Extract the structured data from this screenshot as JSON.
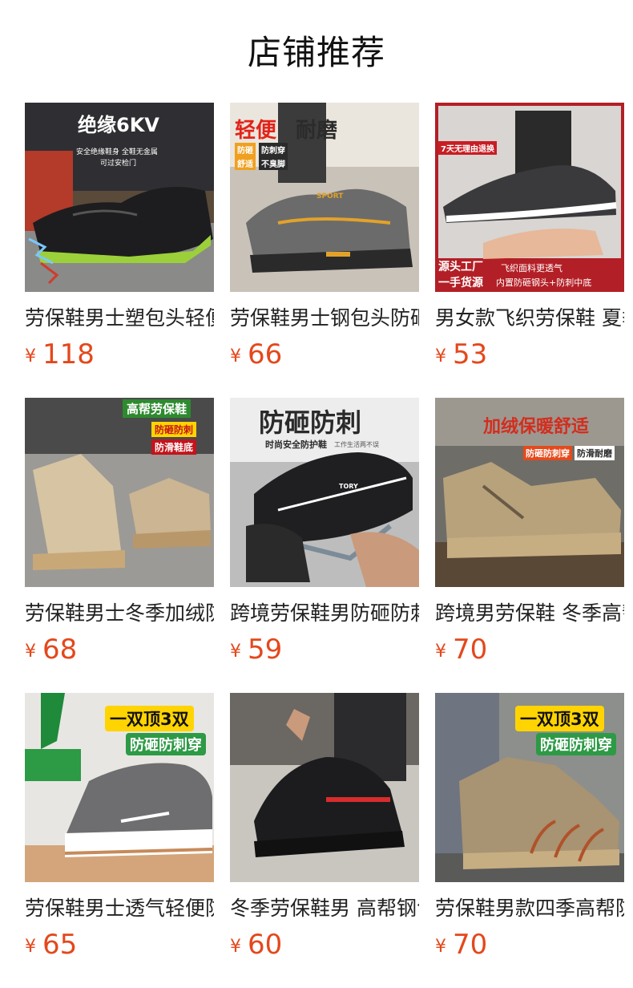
{
  "page": {
    "title": "店铺推荐",
    "currency_symbol": "¥",
    "price_color": "#e4481c"
  },
  "products": [
    {
      "name": "劳保鞋男士塑包头轻便",
      "price": "118",
      "image": {
        "theme": "dark",
        "labels": [
          "绝缘6KV",
          "安全绝缘鞋身 全鞋无金属",
          "可过安检门"
        ]
      }
    },
    {
      "name": "劳保鞋男士钢包头防砸",
      "price": "66",
      "image": {
        "theme": "grey",
        "labels": [
          "轻便",
          "耐磨",
          "防砸",
          "防刺穿",
          "舒适",
          "不臭脚",
          "SPORT"
        ]
      }
    },
    {
      "name": "男女款飞织劳保鞋 夏季",
      "price": "53",
      "image": {
        "theme": "red",
        "labels": [
          "7天无理由退换",
          "源头工厂",
          "一手货源",
          "飞织面料更透气",
          "内置防砸钢头+防刺中底"
        ]
      }
    },
    {
      "name": "劳保鞋男士冬季加绒防砸",
      "price": "68",
      "image": {
        "theme": "beige",
        "labels": [
          "高帮劳保鞋",
          "防砸防刺",
          "防滑鞋底"
        ]
      }
    },
    {
      "name": "跨境劳保鞋男防砸防刺",
      "price": "59",
      "image": {
        "theme": "black",
        "labels": [
          "防砸防刺",
          "时尚安全防护鞋",
          "工作生活两不误",
          "TORY"
        ]
      }
    },
    {
      "name": "跨境男劳保鞋 冬季高帮",
      "price": "70",
      "image": {
        "theme": "khaki",
        "labels": [
          "加绒保暖舒适",
          "防砸防刺穿",
          "防滑耐磨"
        ]
      }
    },
    {
      "name": "劳保鞋男士透气轻便防砸",
      "price": "65",
      "image": {
        "theme": "green",
        "labels": [
          "一双顶3双",
          "防砸防刺穿"
        ]
      }
    },
    {
      "name": "冬季劳保鞋男 高帮钢包头",
      "price": "60",
      "image": {
        "theme": "leather",
        "labels": []
      }
    },
    {
      "name": "劳保鞋男款四季高帮防砸",
      "price": "70",
      "image": {
        "theme": "boot",
        "labels": [
          "一双顶3双",
          "防砸防刺穿"
        ]
      }
    }
  ]
}
